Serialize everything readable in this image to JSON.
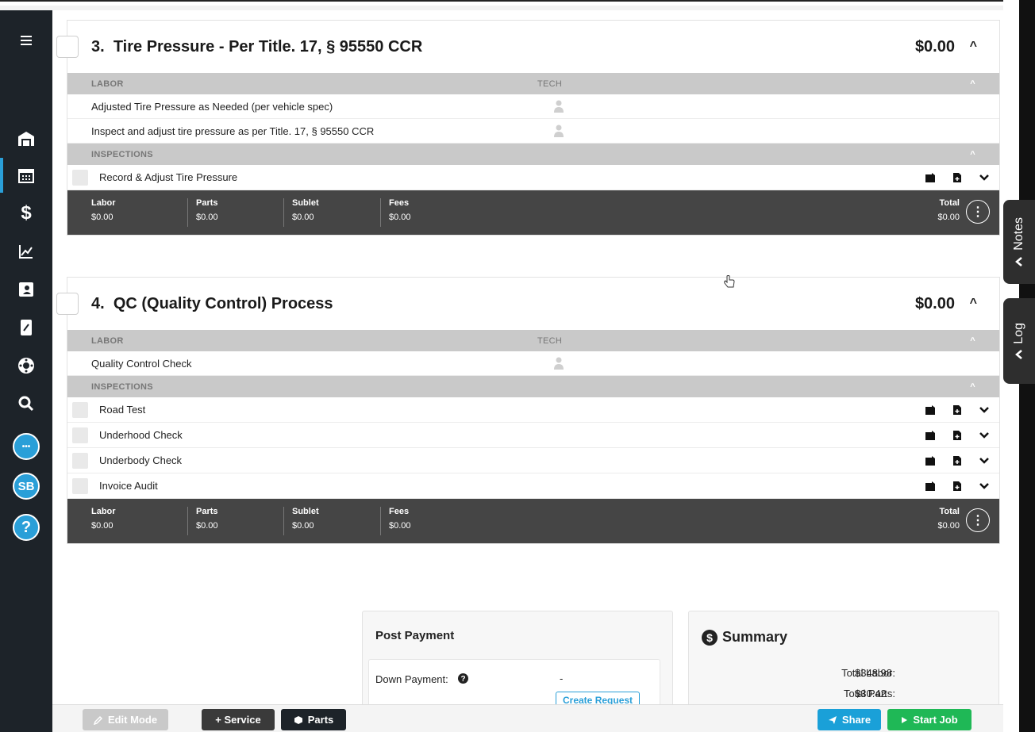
{
  "sidebar": {
    "menu_icon": "hamburger-menu-icon",
    "items": [
      {
        "name": "shop-icon",
        "glyph": "⛩"
      },
      {
        "name": "calendar-icon",
        "glyph": "▦"
      },
      {
        "name": "dollar-icon",
        "glyph": "$"
      },
      {
        "name": "chart-icon",
        "glyph": "↗"
      },
      {
        "name": "contacts-icon",
        "glyph": "▣"
      },
      {
        "name": "inventory-icon",
        "glyph": "▤"
      },
      {
        "name": "tire-icon",
        "glyph": "✺"
      },
      {
        "name": "search-icon",
        "glyph": "⌕"
      }
    ],
    "chat_glyph": "•••",
    "user_initials": "SB",
    "help_glyph": "?"
  },
  "service3": {
    "number": "3.",
    "title": "Tire Pressure - Per Title. 17, § 95550 CCR",
    "amount": "$0.00",
    "labor_header": "LABOR",
    "tech_header": "TECH",
    "labor": [
      "Adjusted Tire Pressure as Needed (per vehicle spec)",
      "Inspect and adjust tire pressure as per Title. 17, § 95550 CCR"
    ],
    "inspections_header": "INSPECTIONS",
    "inspections": [
      "Record & Adjust Tire Pressure"
    ],
    "totals": {
      "labor_label": "Labor",
      "labor": "$0.00",
      "parts_label": "Parts",
      "parts": "$0.00",
      "sublet_label": "Sublet",
      "sublet": "$0.00",
      "fees_label": "Fees",
      "fees": "$0.00",
      "total_label": "Total",
      "total": "$0.00"
    }
  },
  "service4": {
    "number": "4.",
    "title": "QC (Quality Control) Process",
    "amount": "$0.00",
    "labor_header": "LABOR",
    "tech_header": "TECH",
    "labor": [
      "Quality Control Check"
    ],
    "inspections_header": "INSPECTIONS",
    "inspections": [
      "Road Test",
      "Underhood Check",
      "Underbody Check",
      "Invoice Audit"
    ],
    "totals": {
      "labor_label": "Labor",
      "labor": "$0.00",
      "parts_label": "Parts",
      "parts": "$0.00",
      "sublet_label": "Sublet",
      "sublet": "$0.00",
      "fees_label": "Fees",
      "fees": "$0.00",
      "total_label": "Total",
      "total": "$0.00"
    }
  },
  "right_tabs": {
    "notes": "Notes",
    "log": "Log"
  },
  "post_payment": {
    "title": "Post Payment",
    "down_payment_label": "Down Payment:",
    "down_payment_value": "-",
    "create_request": "Create Request"
  },
  "summary": {
    "title": "Summary",
    "total_labor_label": "Total Labor:",
    "total_labor": "$348.98",
    "total_parts_label": "Total Parts:",
    "total_parts": "$30.42"
  },
  "toolbar": {
    "edit_mode": "Edit Mode",
    "service": "+ Service",
    "parts": "Parts",
    "share": "Share",
    "start_job": "Start Job"
  },
  "colors": {
    "sidebar": "#1d2329",
    "accent": "#2a9fd8",
    "totals_bar": "#454545",
    "share": "#1aa0d8",
    "start_job": "#1fb856"
  }
}
